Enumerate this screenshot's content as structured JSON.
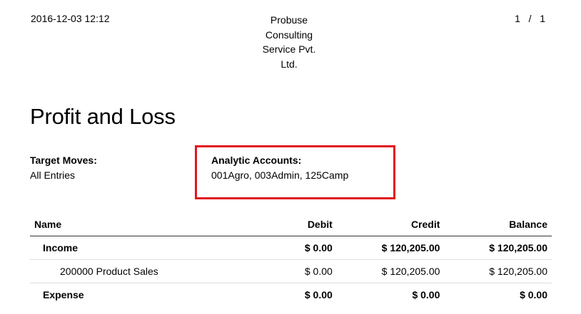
{
  "header": {
    "date": "2016-12-03 12:12",
    "company": [
      "Probuse",
      "Consulting",
      "Service Pvt.",
      "Ltd."
    ],
    "page_current": "1",
    "page_sep": "/",
    "page_total": "1"
  },
  "report": {
    "title": "Profit and Loss",
    "filters": {
      "target_moves_label": "Target Moves:",
      "target_moves_value": "All Entries",
      "analytic_label": "Analytic Accounts:",
      "analytic_value": "001Agro, 003Admin, 125Camp"
    },
    "highlight_color": "#e2141d",
    "columns": {
      "name": "Name",
      "debit": "Debit",
      "credit": "Credit",
      "balance": "Balance"
    },
    "rows": [
      {
        "name": "Income",
        "debit": "$ 0.00",
        "credit": "$ 120,205.00",
        "balance": "$ 120,205.00"
      },
      {
        "name": "200000 Product Sales",
        "debit": "$ 0.00",
        "credit": "$ 120,205.00",
        "balance": "$ 120,205.00"
      },
      {
        "name": "Expense",
        "debit": "$ 0.00",
        "credit": "$ 0.00",
        "balance": "$ 0.00"
      }
    ]
  }
}
